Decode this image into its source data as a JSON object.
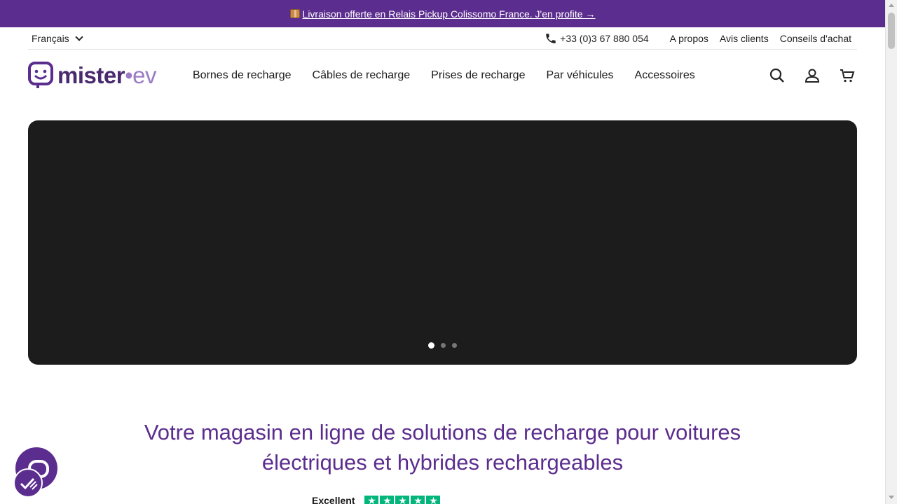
{
  "announcement": {
    "text": "Livraison offerte en Relais Pickup Colissomo France. J'en profite →",
    "icon": "package-icon"
  },
  "topbar": {
    "language": "Français",
    "phone": "+33 (0)3 67 880 054",
    "links": [
      "A propos",
      "Avis clients",
      "Conseils d'achat"
    ]
  },
  "header": {
    "logo": {
      "word1": "mister",
      "dot": "•",
      "word2": "ev"
    },
    "nav": [
      "Bornes de recharge",
      "Câbles de recharge",
      "Prises de recharge",
      "Par véhicules",
      "Accessoires"
    ],
    "icons": [
      "search-icon",
      "account-icon",
      "cart-icon"
    ]
  },
  "hero": {
    "slides_count": 3,
    "active_slide": 1
  },
  "headline": {
    "line1": "Votre magasin en ligne de solutions de recharge pour voitures",
    "line2": "électriques et hybrides rechargeables"
  },
  "trustpilot": {
    "rating_word": "Excellent",
    "stars": 5
  },
  "colors": {
    "brand": "#5b2d8e",
    "hero_bg": "#1c1c1c",
    "trust_green": "#00b67a"
  }
}
